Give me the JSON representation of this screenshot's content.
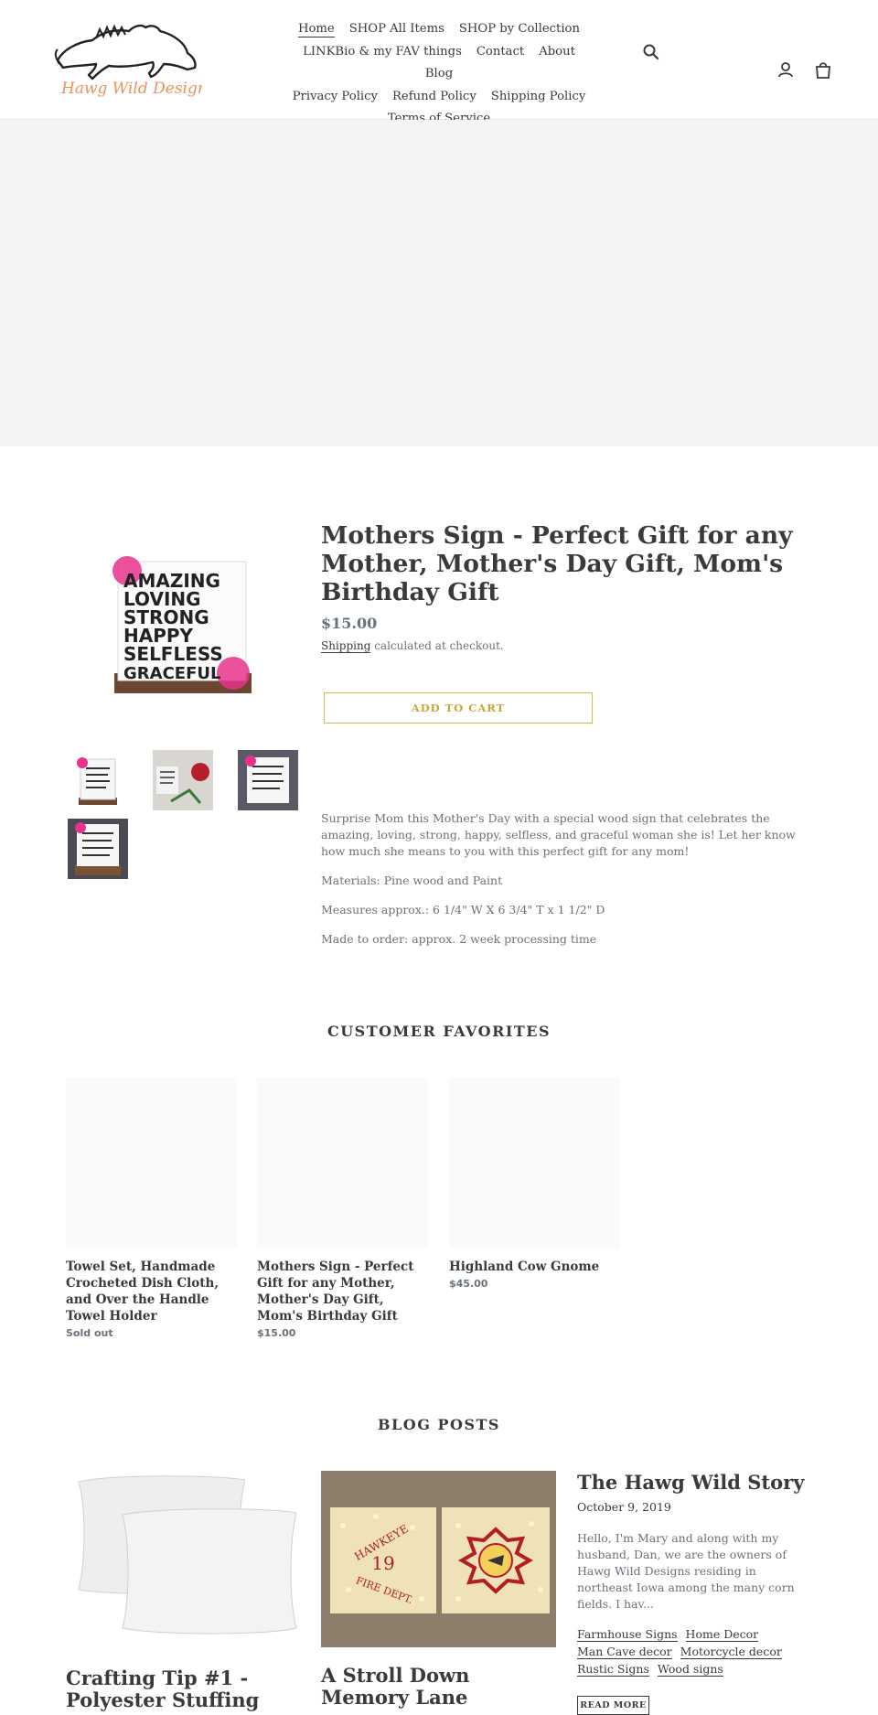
{
  "header": {
    "logo_text": "Hawg Wild Designs",
    "nav": [
      [
        "Home",
        "SHOP All Items",
        "SHOP by Collection"
      ],
      [
        "LINKBio & my FAV things",
        "Contact",
        "About",
        "Blog"
      ],
      [
        "Privacy Policy",
        "Refund Policy",
        "Shipping Policy"
      ],
      [
        "Terms of Service"
      ]
    ],
    "icons": [
      "search-icon",
      "account-icon",
      "cart-icon"
    ]
  },
  "product": {
    "title": "Mothers Sign - Perfect Gift for any Mother, Mother's Day Gift, Mom's Birthday Gift",
    "price": "$15.00",
    "shipping_link": "Shipping",
    "shipping_rest": " calculated at checkout.",
    "add_to_cart": "ADD TO CART",
    "sign_lines": [
      "AMAZING",
      "LOVING",
      "STRONG",
      "HAPPY",
      "SELFLESS",
      "GRACEFUL"
    ],
    "description": [
      "Surprise Mom this Mother's Day with a special wood sign that celebrates the amazing, loving, strong, happy, selfless, and graceful woman she is! Let her know how much she means to you with this perfect gift for any mom!",
      "Materials: Pine wood and Paint",
      "Measures approx.: 6 1/4\" W X 6 3/4\" T x 1 1/2\" D",
      "Made to order: approx. 2 week processing time"
    ]
  },
  "favorites": {
    "title": "CUSTOMER FAVORITES",
    "items": [
      {
        "title": "Towel Set, Handmade Crocheted Dish Cloth, and Over the Handle Towel Holder",
        "price": "Sold out"
      },
      {
        "title": "Mothers Sign - Perfect Gift for any Mother, Mother's Day Gift, Mom's Birthday Gift",
        "price": "$15.00"
      },
      {
        "title": "Highland Cow Gnome",
        "price": "$45.00"
      }
    ]
  },
  "blog": {
    "title": "BLOG POSTS",
    "posts": [
      {
        "title": "Crafting Tip #1 - Polyester Stuffing"
      },
      {
        "title": "A Stroll Down Memory Lane",
        "image_text_left": [
          "HAWKEYE",
          "19",
          "FIRE DEPT."
        ]
      },
      {
        "title": "The Hawg Wild Story",
        "date": "October 9, 2019",
        "excerpt": "Hello, I'm Mary and along with my husband, Dan, we are the owners of Hawg Wild Designs residing in northeast Iowa among the many corn fields. I hav...",
        "tags": [
          "Farmhouse Signs",
          "Home Decor",
          "Man Cave decor",
          "Motorcycle decor",
          "Rustic Signs",
          "Wood signs"
        ],
        "read_more": "READ MORE"
      }
    ]
  },
  "colors": {
    "text": "#3a3a3a",
    "muted": "#69727b",
    "accent": "#d6b94a",
    "banner": "#f4f4f4",
    "logo_orange": "#e8935a",
    "pink": "#e8338c"
  }
}
